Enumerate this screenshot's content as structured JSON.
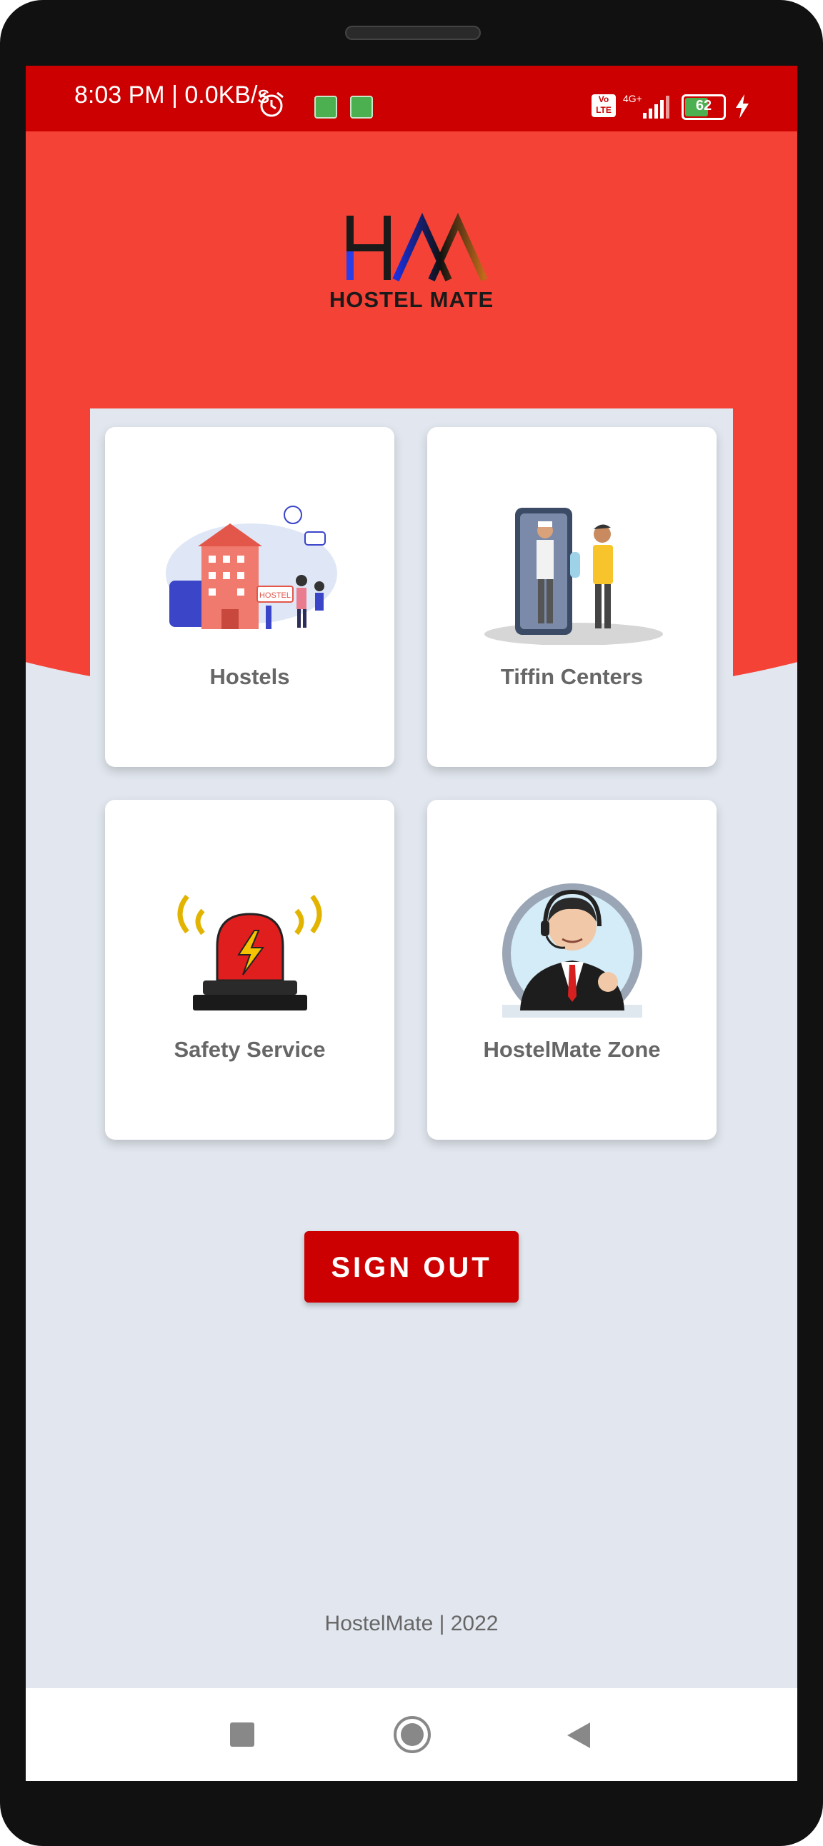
{
  "status_bar": {
    "time_speed": "8:03 PM | 0.0KB/s",
    "volte_label": "Vo LTE",
    "network": "4G+",
    "battery": "62",
    "background_color": "#cc0000"
  },
  "header": {
    "logo_text": "HOSTEL MATE",
    "background_color": "#f44336"
  },
  "cards": [
    {
      "label": "Hostels",
      "icon": "hostel-illustration"
    },
    {
      "label": "Tiffin Centers",
      "icon": "tiffin-delivery-illustration"
    },
    {
      "label": "Safety Service",
      "icon": "siren-alarm-illustration"
    },
    {
      "label": "HostelMate Zone",
      "icon": "support-agent-illustration"
    }
  ],
  "actions": {
    "sign_out_label": "SIGN OUT"
  },
  "footer": {
    "text": "HostelMate | 2022"
  },
  "nav": {
    "icons": [
      "recent-apps-icon",
      "home-icon",
      "back-icon"
    ]
  }
}
